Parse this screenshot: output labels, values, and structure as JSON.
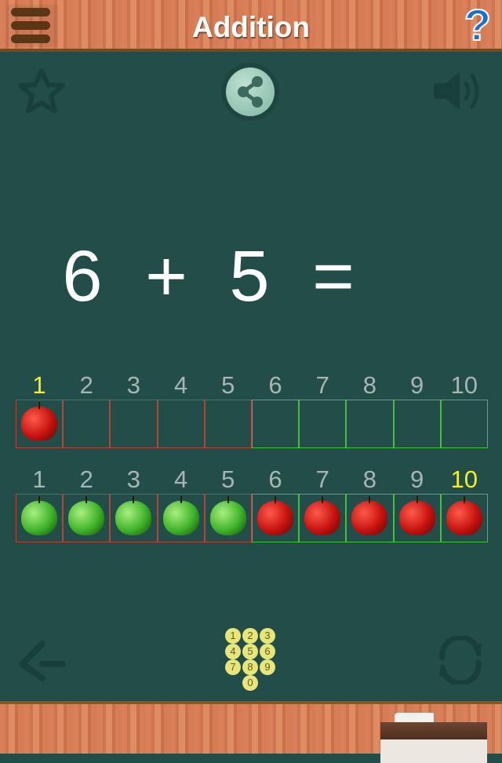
{
  "header": {
    "title": "Addition",
    "menu_icon": "hamburger-icon",
    "help_icon": "question-icon",
    "help_glyph": "?"
  },
  "toolbar": {
    "favorite_icon": "star-icon",
    "share_icon": "share-icon",
    "sound_icon": "speaker-icon"
  },
  "equation": {
    "a": "6",
    "op": "+",
    "b": "5",
    "eq": "="
  },
  "rows": [
    {
      "numbers": [
        "1",
        "2",
        "3",
        "4",
        "5",
        "6",
        "7",
        "8",
        "9",
        "10"
      ],
      "highlight_index": 0,
      "apples": [
        "red",
        null,
        null,
        null,
        null,
        null,
        null,
        null,
        null,
        null
      ]
    },
    {
      "numbers": [
        "1",
        "2",
        "3",
        "4",
        "5",
        "6",
        "7",
        "8",
        "9",
        "10"
      ],
      "highlight_index": 9,
      "apples": [
        "green",
        "green",
        "green",
        "green",
        "green",
        "red",
        "red",
        "red",
        "red",
        "red"
      ]
    }
  ],
  "footer": {
    "back_icon": "back-arrow-icon",
    "keypad_icon": "number-keypad-icon",
    "keypad_keys": [
      "1",
      "2",
      "3",
      "4",
      "5",
      "6",
      "7",
      "8",
      "9",
      "0"
    ],
    "refresh_icon": "refresh-icon",
    "eraser_icon": "chalk-eraser-icon"
  },
  "colors": {
    "board": "#234d49",
    "highlight": "#f5f01a",
    "first_addend_border": "#b8433a",
    "second_addend_border": "#3fc23a"
  }
}
